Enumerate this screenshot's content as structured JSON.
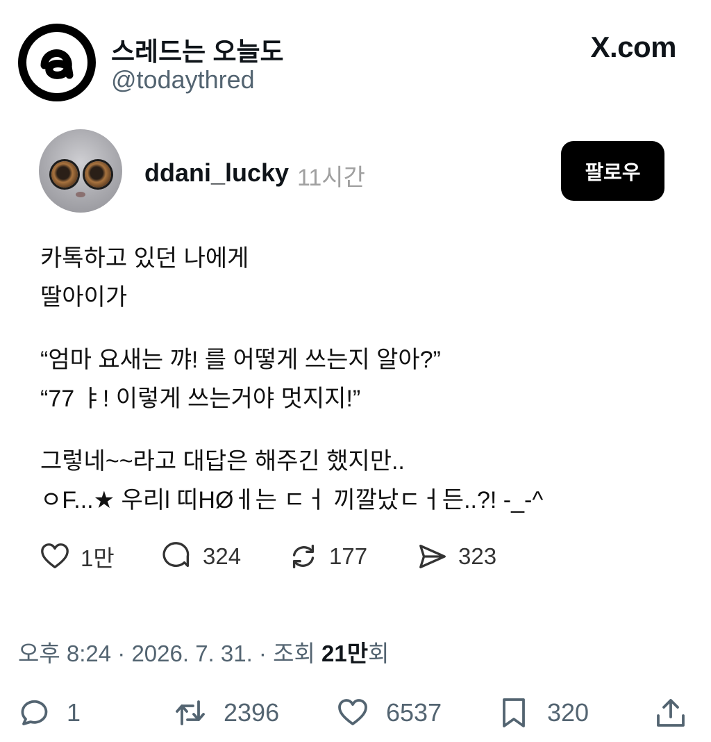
{
  "header": {
    "account_name": "스레드는 오늘도",
    "handle": "@todaythred",
    "site": "X.com",
    "logo_icon": "threads-logo-icon"
  },
  "threads_post": {
    "username": "ddani_lucky",
    "time": "11시간",
    "follow_label": "팔로우",
    "lines": [
      "카톡하고 있던 나에게",
      "딸아이가",
      "“엄마 요새는 꺄! 를 어떻게 쓰는지 알아?”",
      "“77 ㅑ! 이렇게 쓰는거야 멋지지!”",
      "그렇네~~라고 대답은 해주긴 했지만..",
      "ㅇF...★ 우리l 띠HØㅔ는 ㄷㅓ 끼깔났ㄷㅓ든..?! -_-^"
    ],
    "stats": {
      "likes": "1만",
      "comments": "324",
      "reposts": "177",
      "shares": "323"
    }
  },
  "tweet_meta": {
    "prefix": "오후 8:24 · 2026. 7. 31. · 조회 ",
    "views": "21만",
    "suffix": "회"
  },
  "tweet_actions": {
    "replies": "1",
    "retweets": "2396",
    "likes": "6537",
    "bookmarks": "320"
  }
}
